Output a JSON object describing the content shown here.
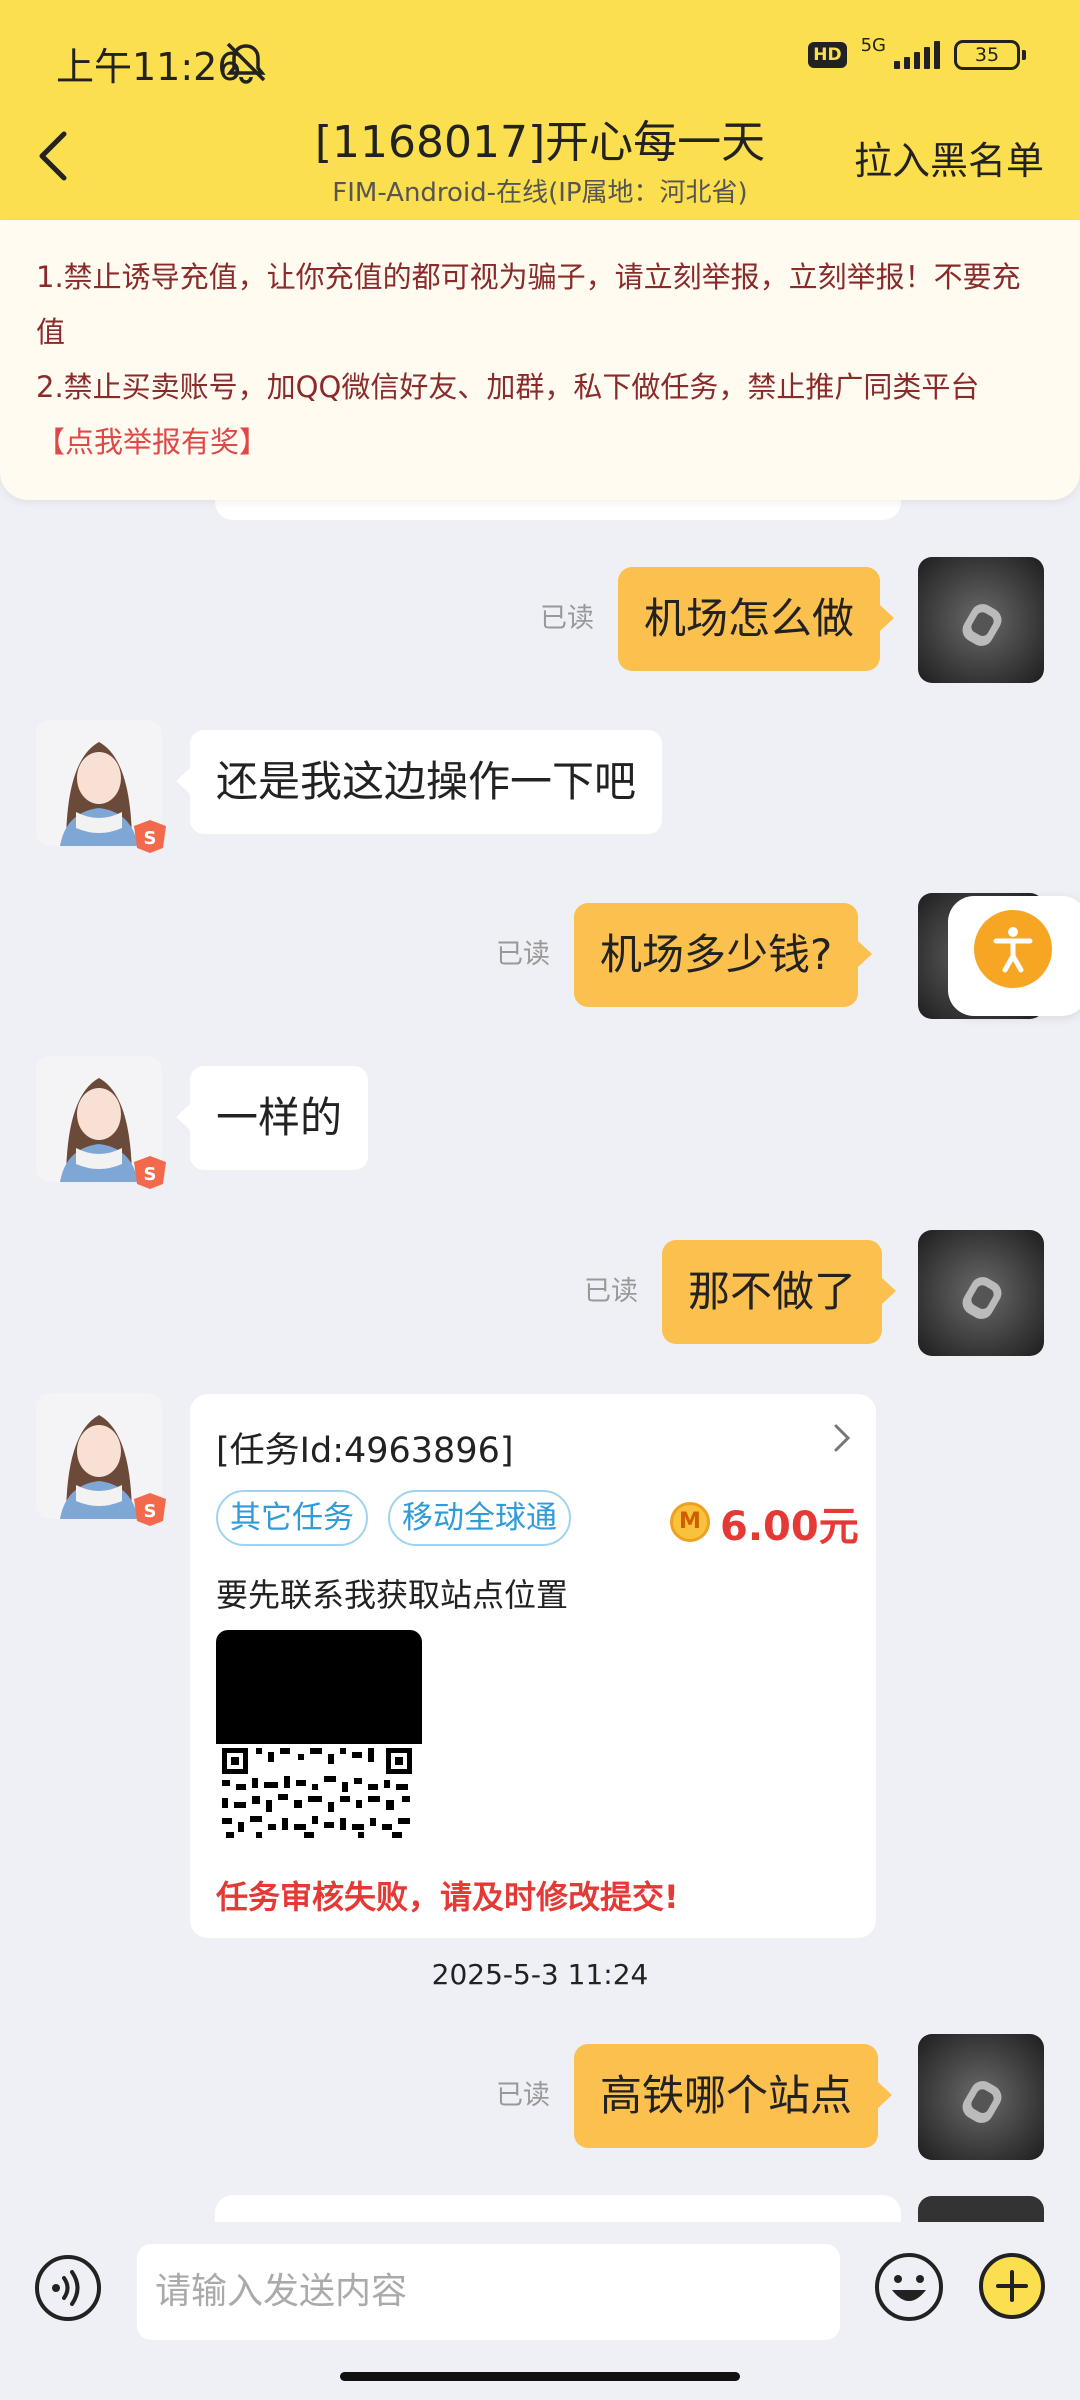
{
  "status_bar": {
    "time": "上午11:26",
    "hd": "HD",
    "network": "5G",
    "battery": "35"
  },
  "header": {
    "title": "[1168017]开心每一天",
    "subtitle": "FIM-Android-在线(IP属地：河北省)",
    "blacklist_label": "拉入黑名单"
  },
  "notice": {
    "line1": "1.禁止诱导充值，让你充值的都可视为骗子，请立刻举报，立刻举报！不要充值",
    "line2": "2.禁止买卖账号，加QQ微信好友、加群，私下做任务，禁止推广同类平台",
    "report_link": "【点我举报有奖】"
  },
  "messages": [
    {
      "from": "me",
      "text": "机场怎么做",
      "status": "已读"
    },
    {
      "from": "other",
      "text": "还是我这边操作一下吧"
    },
    {
      "from": "me",
      "text": "机场多少钱?",
      "status": "已读"
    },
    {
      "from": "other",
      "text": "一样的"
    },
    {
      "from": "me",
      "text": "那不做了",
      "status": "已读"
    },
    {
      "from": "me",
      "text": "高铁哪个站点",
      "status": "已读"
    }
  ],
  "task_card": {
    "task_id": "[任务Id:4963896]",
    "tags": [
      "其它任务",
      "移动全球通"
    ],
    "coin_icon": "M",
    "price": "6.00元",
    "description": "要先联系我获取站点位置",
    "status": "任务审核失败，请及时修改提交!"
  },
  "timestamp": "2025-5-3 11:24",
  "input": {
    "placeholder": "请输入发送内容"
  },
  "colors": {
    "header": "#fbdf4e",
    "my_bubble": "#fbc04e",
    "background": "#eff0f6",
    "price": "#e53935",
    "tag": "#2f9bd8"
  }
}
